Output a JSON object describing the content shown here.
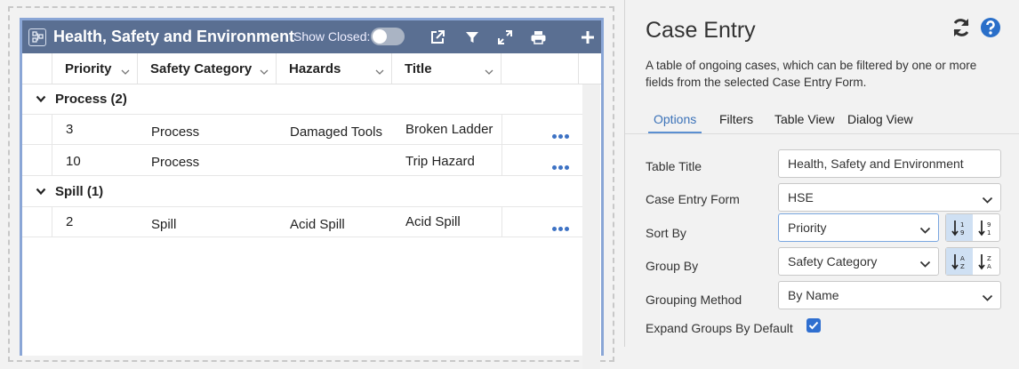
{
  "widget": {
    "title": "Health, Safety and Environment",
    "show_closed_label": "Show Closed:",
    "show_closed_on": false,
    "header_icons": [
      "external-link-icon",
      "filter-icon",
      "expand-icon",
      "print-icon",
      "add-icon"
    ],
    "columns": [
      "Priority",
      "Safety Category",
      "Hazards",
      "Title"
    ],
    "groups": [
      {
        "label": "Process (2)",
        "rows": [
          {
            "priority": "3",
            "category": "Process",
            "hazards": "Damaged Tools",
            "title": "Broken Ladder"
          },
          {
            "priority": "10",
            "category": "Process",
            "hazards": "",
            "title": "Trip Hazard"
          }
        ]
      },
      {
        "label": "Spill (1)",
        "rows": [
          {
            "priority": "2",
            "category": "Spill",
            "hazards": "Acid Spill",
            "title": "Acid Spill"
          }
        ]
      }
    ]
  },
  "panel": {
    "title": "Case Entry",
    "description": "A table of ongoing cases, which can be filtered by one or more fields from the selected Case Entry Form.",
    "tabs": [
      "Options",
      "Filters",
      "Table View",
      "Dialog View"
    ],
    "active_tab": "Options",
    "fields": {
      "table_title_label": "Table Title",
      "table_title_value": "Health, Safety and Environment",
      "case_entry_form_label": "Case Entry Form",
      "case_entry_form_value": "HSE",
      "sort_by_label": "Sort By",
      "sort_by_value": "Priority",
      "group_by_label": "Group By",
      "group_by_value": "Safety Category",
      "grouping_method_label": "Grouping Method",
      "grouping_method_value": "By Name",
      "expand_groups_label": "Expand Groups By Default",
      "expand_groups_checked": true
    },
    "colors": {
      "accent": "#3b72b8",
      "header_bg": "#5a6f92",
      "checkbox": "#2f6fd0"
    }
  }
}
